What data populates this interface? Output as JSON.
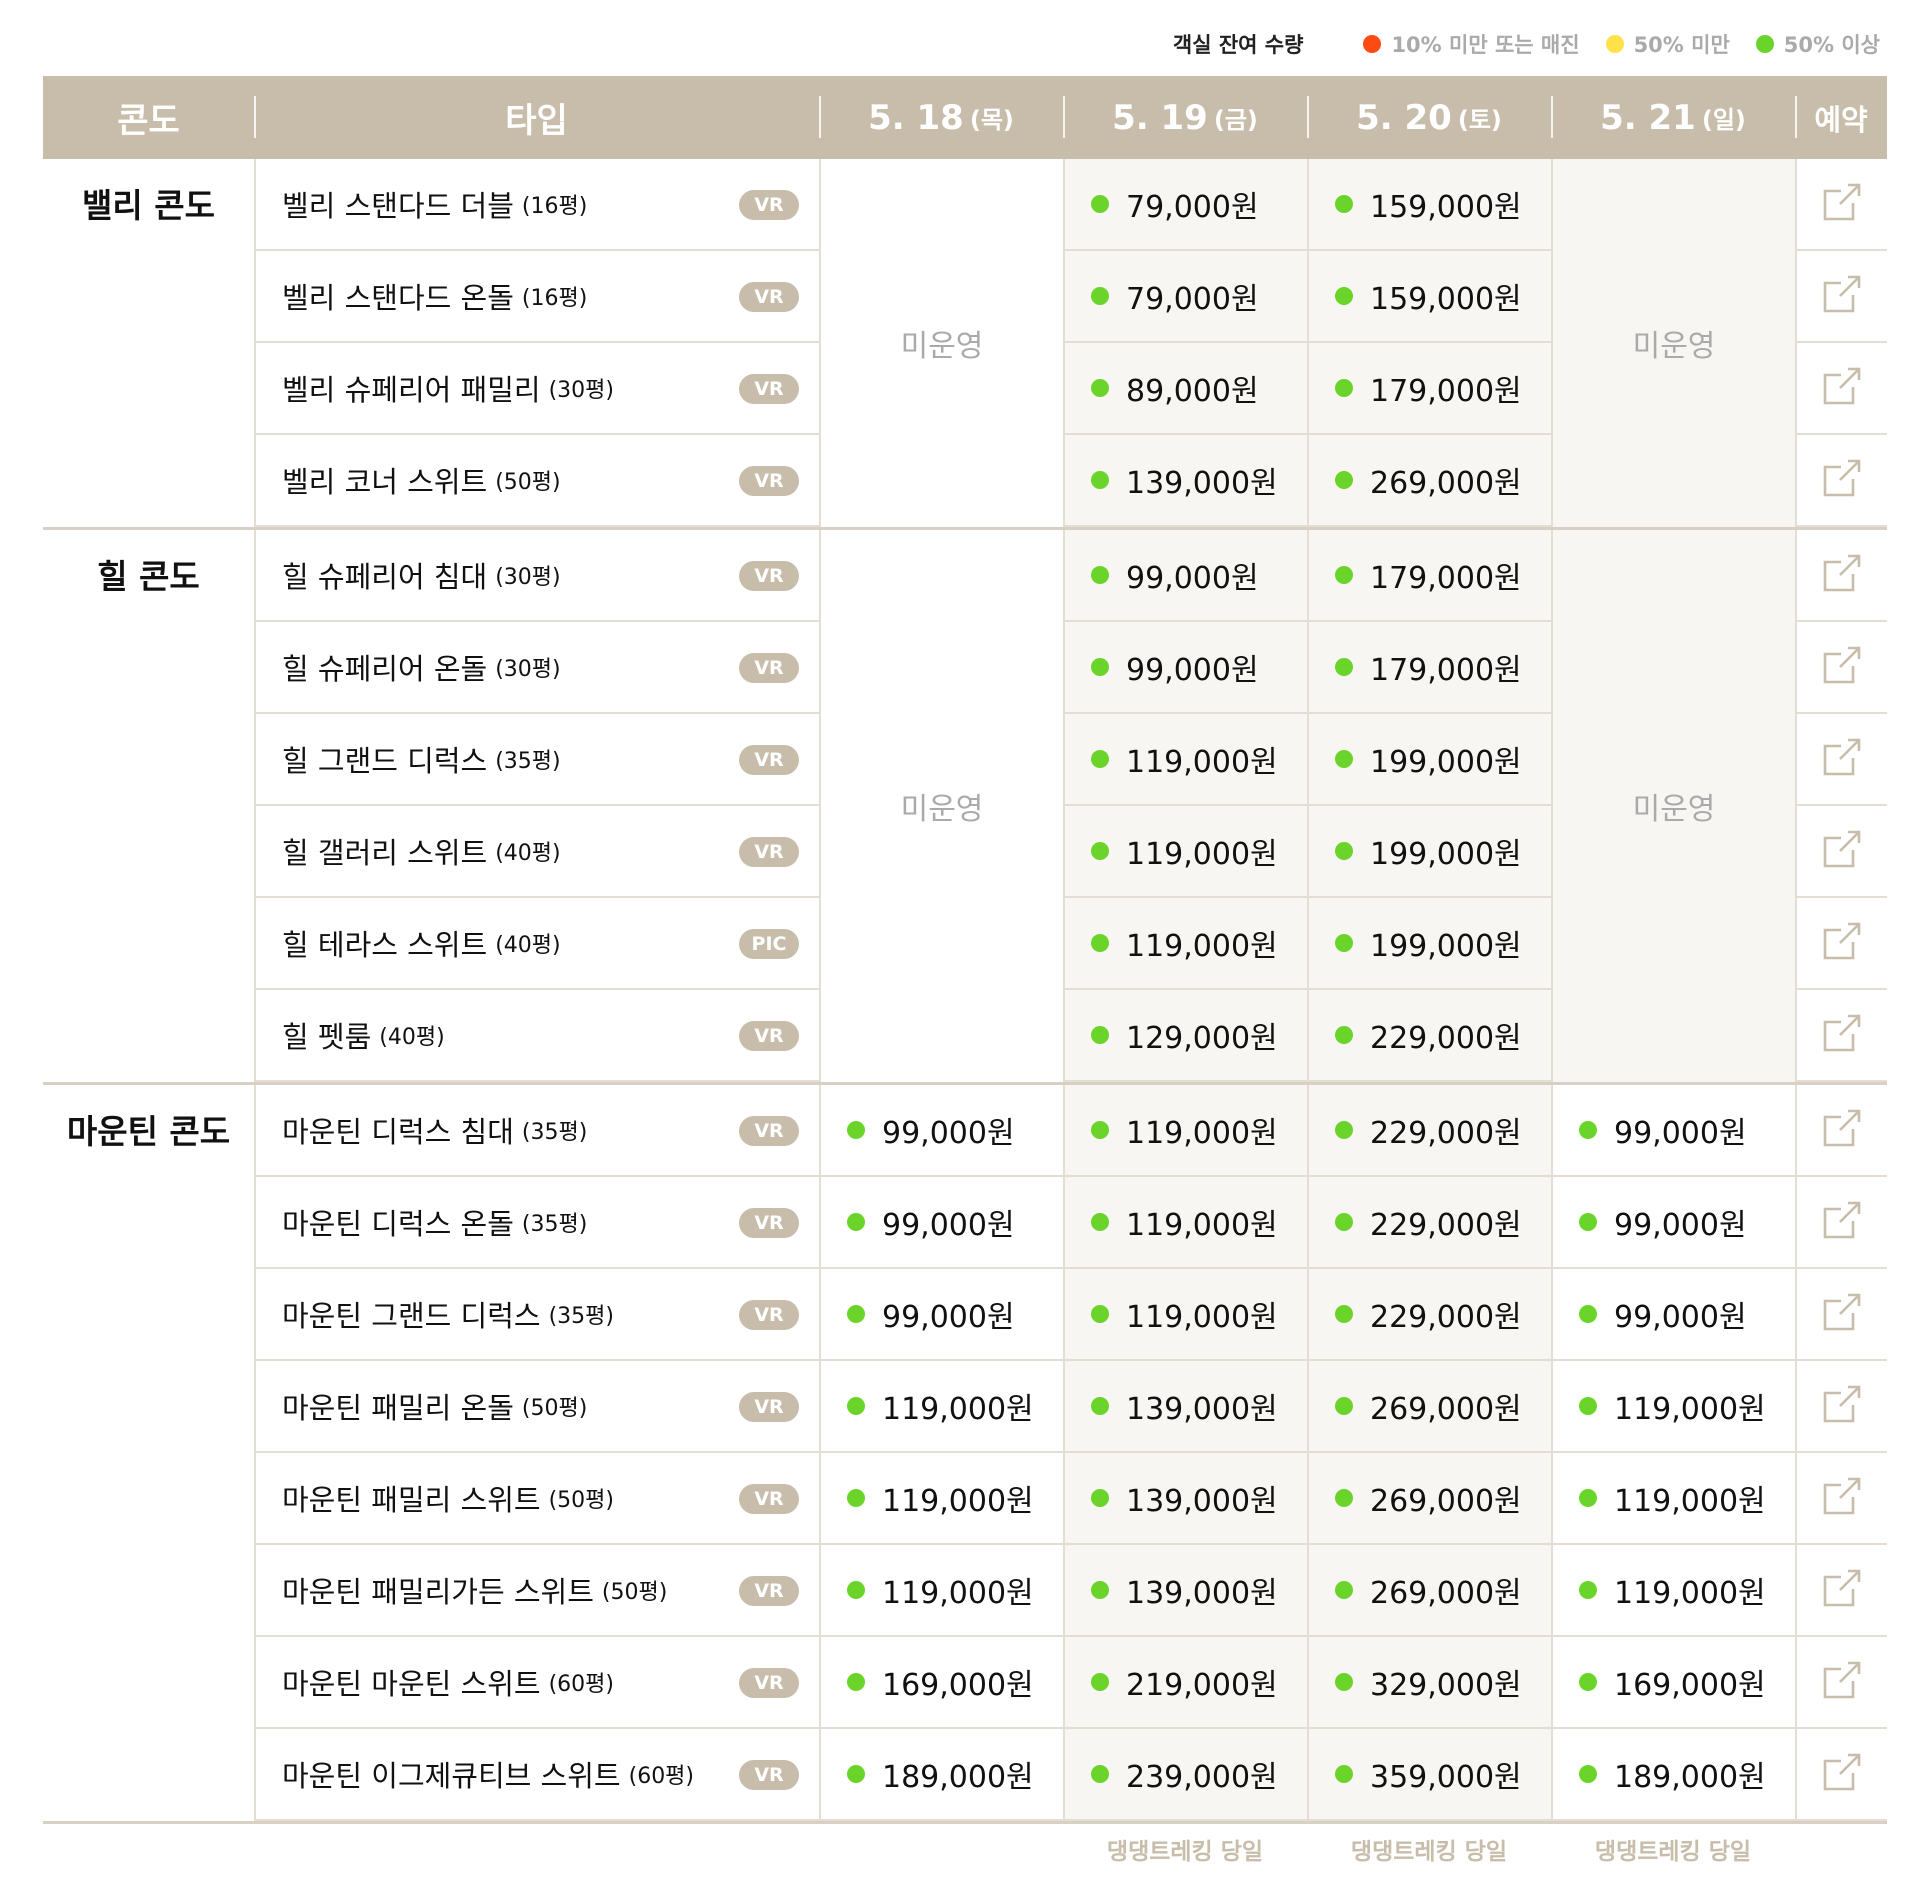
{
  "legend": {
    "title": "객실 잔여 수량",
    "items": [
      {
        "label": "10% 미만 또는 매진",
        "color": "#ff4a12"
      },
      {
        "label": "50% 미만",
        "color": "#ffe14a"
      },
      {
        "label": "50% 이상",
        "color": "#6bd42b"
      }
    ]
  },
  "header": {
    "condo": "콘도",
    "type": "타입",
    "dates": [
      {
        "date": "5. 18",
        "day": "(목)"
      },
      {
        "date": "5. 19",
        "day": "(금)"
      },
      {
        "date": "5. 20",
        "day": "(토)"
      },
      {
        "date": "5. 21",
        "day": "(일)"
      }
    ],
    "booking": "예약"
  },
  "closed_label": "미운영",
  "groups": [
    {
      "name": "밸리 콘도",
      "closed_cols": [
        1,
        4
      ],
      "rows": [
        {
          "type": "벨리 스탠다드 더블",
          "size": "(16평)",
          "badge": "VR",
          "prices": [
            "",
            "79,000원",
            "159,000원",
            ""
          ]
        },
        {
          "type": "벨리 스탠다드 온돌",
          "size": "(16평)",
          "badge": "VR",
          "prices": [
            "",
            "79,000원",
            "159,000원",
            ""
          ]
        },
        {
          "type": "벨리 슈페리어 패밀리",
          "size": "(30평)",
          "badge": "VR",
          "prices": [
            "",
            "89,000원",
            "179,000원",
            ""
          ]
        },
        {
          "type": "벨리 코너 스위트",
          "size": "(50평)",
          "badge": "VR",
          "prices": [
            "",
            "139,000원",
            "269,000원",
            ""
          ]
        }
      ]
    },
    {
      "name": "힐 콘도",
      "closed_cols": [
        1,
        4
      ],
      "rows": [
        {
          "type": "힐 슈페리어 침대",
          "size": "(30평)",
          "badge": "VR",
          "prices": [
            "",
            "99,000원",
            "179,000원",
            ""
          ]
        },
        {
          "type": "힐 슈페리어 온돌",
          "size": "(30평)",
          "badge": "VR",
          "prices": [
            "",
            "99,000원",
            "179,000원",
            ""
          ]
        },
        {
          "type": "힐 그랜드 디럭스",
          "size": "(35평)",
          "badge": "VR",
          "prices": [
            "",
            "119,000원",
            "199,000원",
            ""
          ]
        },
        {
          "type": "힐 갤러리 스위트",
          "size": "(40평)",
          "badge": "VR",
          "prices": [
            "",
            "119,000원",
            "199,000원",
            ""
          ]
        },
        {
          "type": "힐 테라스 스위트",
          "size": "(40평)",
          "badge": "PIC",
          "prices": [
            "",
            "119,000원",
            "199,000원",
            ""
          ]
        },
        {
          "type": "힐 펫룸",
          "size": "(40평)",
          "badge": "VR",
          "prices": [
            "",
            "129,000원",
            "229,000원",
            ""
          ]
        }
      ]
    },
    {
      "name": "마운틴 콘도",
      "closed_cols": [],
      "rows": [
        {
          "type": "마운틴 디럭스 침대",
          "size": "(35평)",
          "badge": "VR",
          "prices": [
            "99,000원",
            "119,000원",
            "229,000원",
            "99,000원"
          ]
        },
        {
          "type": "마운틴 디럭스 온돌",
          "size": "(35평)",
          "badge": "VR",
          "prices": [
            "99,000원",
            "119,000원",
            "229,000원",
            "99,000원"
          ]
        },
        {
          "type": "마운틴 그랜드 디럭스",
          "size": "(35평)",
          "badge": "VR",
          "prices": [
            "99,000원",
            "119,000원",
            "229,000원",
            "99,000원"
          ]
        },
        {
          "type": "마운틴 패밀리 온돌",
          "size": "(50평)",
          "badge": "VR",
          "prices": [
            "119,000원",
            "139,000원",
            "269,000원",
            "119,000원"
          ]
        },
        {
          "type": "마운틴 패밀리 스위트",
          "size": "(50평)",
          "badge": "VR",
          "prices": [
            "119,000원",
            "139,000원",
            "269,000원",
            "119,000원"
          ]
        },
        {
          "type": "마운틴 패밀리가든 스위트",
          "size": "(50평)",
          "badge": "VR",
          "prices": [
            "119,000원",
            "139,000원",
            "269,000원",
            "119,000원"
          ]
        },
        {
          "type": "마운틴 마운틴 스위트",
          "size": "(60평)",
          "badge": "VR",
          "prices": [
            "169,000원",
            "219,000원",
            "329,000원",
            "169,000원"
          ]
        },
        {
          "type": "마운틴 이그제큐티브 스위트",
          "size": "(60평)",
          "badge": "VR",
          "prices": [
            "189,000원",
            "239,000원",
            "359,000원",
            "189,000원"
          ]
        }
      ]
    }
  ],
  "footnotes": [
    "",
    "댕댕트레킹 당일",
    "댕댕트레킹 당일",
    "댕댕트레킹 당일"
  ]
}
